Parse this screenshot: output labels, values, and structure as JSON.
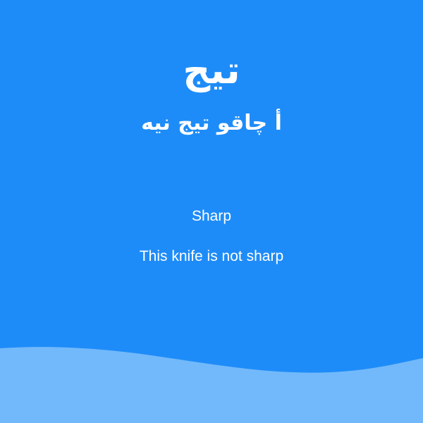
{
  "card": {
    "word": "تيج",
    "sentence": "أ چاقو تيج نيه",
    "translation": "Sharp",
    "sentence_translation": "This knife is not sharp"
  },
  "colors": {
    "background": "#1e8cf8",
    "wave": "#72b9fb",
    "text": "#ffffff"
  }
}
